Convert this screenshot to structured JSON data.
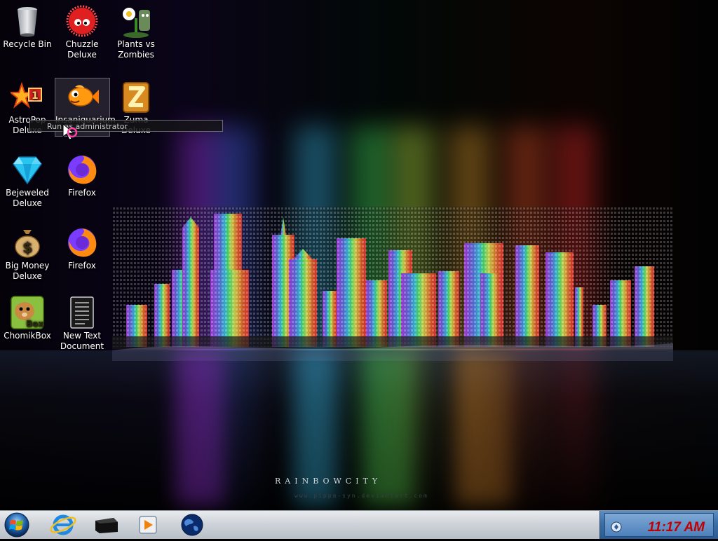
{
  "desktop": {
    "icons": [
      {
        "label": "Recycle Bin",
        "icon": "recycle-bin-icon"
      },
      {
        "label": "Chuzzle Deluxe",
        "icon": "chuzzle-icon"
      },
      {
        "label": "Plants vs Zombies",
        "icon": "plants-vs-zombies-icon"
      },
      {
        "label": "AstroPop Deluxe",
        "icon": "astropop-icon"
      },
      {
        "label": "Insaniquarium",
        "icon": "insaniquarium-icon"
      },
      {
        "label": "Zuma Deluxe",
        "icon": "zuma-icon"
      },
      {
        "label": "Bejeweled Deluxe",
        "icon": "bejeweled-icon"
      },
      {
        "label": "Firefox",
        "icon": "firefox-icon"
      },
      {
        "label": "Big Money Deluxe",
        "icon": "big-money-icon"
      },
      {
        "label": "Firefox",
        "icon": "firefox-icon"
      },
      {
        "label": "ChomikBox",
        "icon": "chomikbox-icon"
      },
      {
        "label": "New Text Document",
        "icon": "text-document-icon"
      }
    ],
    "tooltip": "Run as administrator",
    "wallpaper_title": "RAINBOWCITY",
    "wallpaper_url": "www.pippa-syn.deviantart.com"
  },
  "taskbar": {
    "start_icon": "windows-start-icon",
    "pinned": [
      {
        "name": "Internet Explorer",
        "icon": "internet-explorer-icon"
      },
      {
        "name": "Terminal",
        "icon": "terminal-icon"
      },
      {
        "name": "Media Player",
        "icon": "media-player-icon"
      },
      {
        "name": "Globe",
        "icon": "globe-icon"
      }
    ],
    "clock": "11:17 AM",
    "tray_icon": "network-icon"
  },
  "colors": {
    "taskbar": "#cfd4d9",
    "tray": "#3c6ea6",
    "clock": "#c00000"
  }
}
